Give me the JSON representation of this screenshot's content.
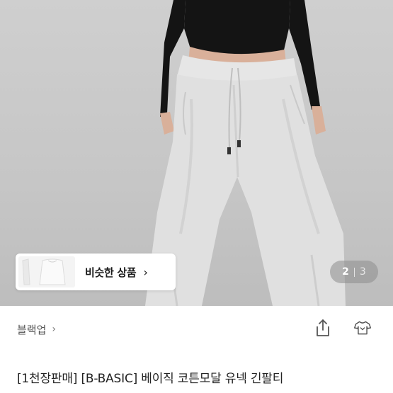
{
  "hero": {
    "image_alt": "model wearing light grey wide sweatpants and black long-sleeve top",
    "similar_products": {
      "label": "비슷한 상품",
      "chevron": "chevron-right-icon"
    },
    "pagination": {
      "current": "2",
      "total": "3"
    }
  },
  "store": {
    "name": "블랙업",
    "chevron": "chevron-right-icon"
  },
  "actions": {
    "share_icon": "share-icon",
    "fitting_icon": "tshirt-icon"
  },
  "product": {
    "title": "[1천장판매] [B-BASIC] 베이직 코튼모달 유넥 긴팔티"
  },
  "colors": {
    "background": "#c8c8c8",
    "pants": "#e2e2e2",
    "top": "#141414",
    "skin": "#d9b09a"
  }
}
